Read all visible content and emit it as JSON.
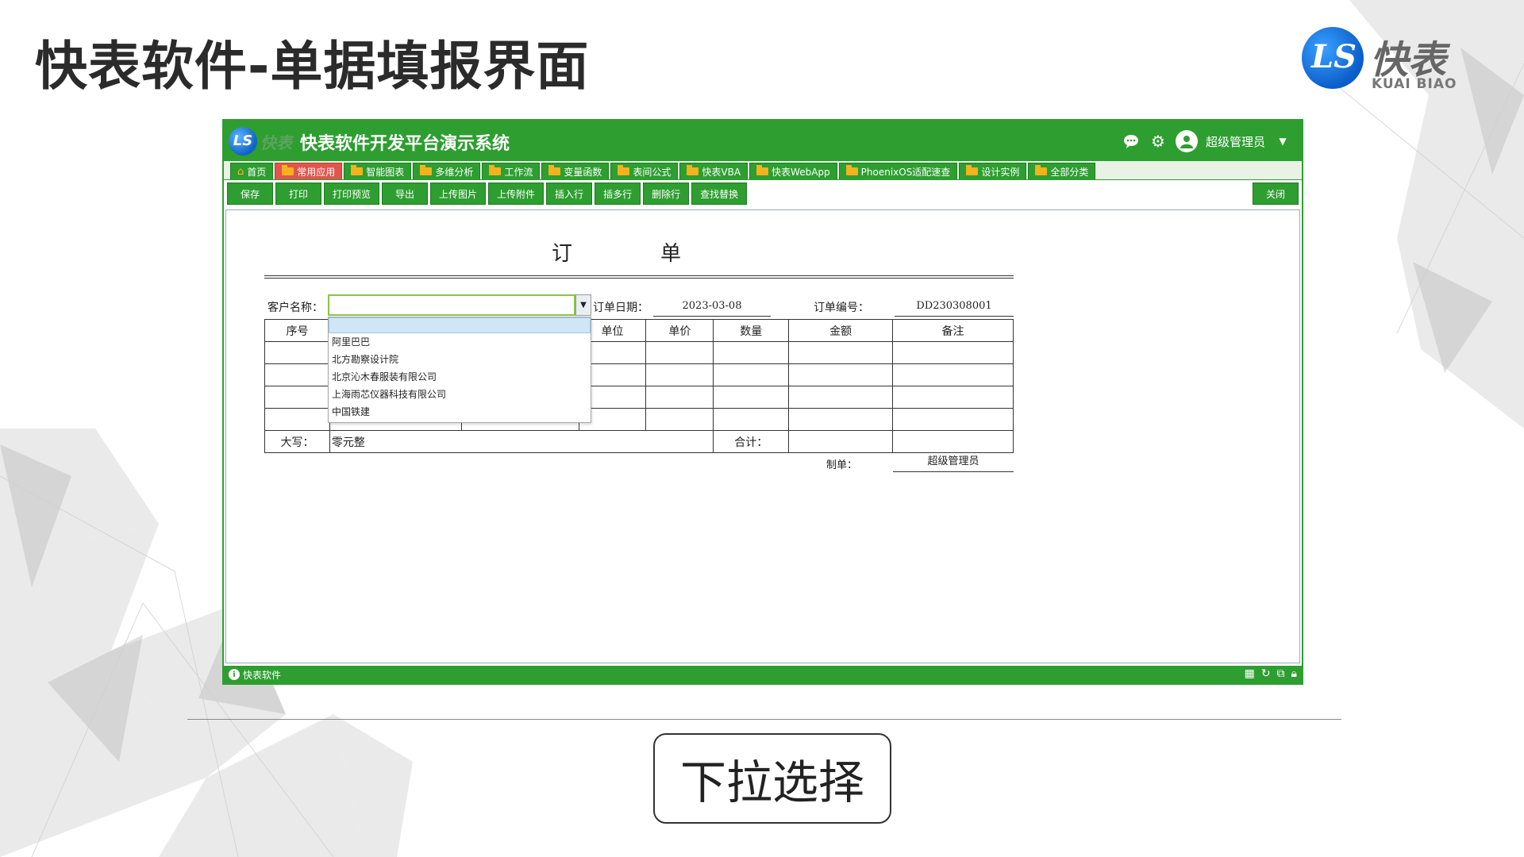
{
  "slide": {
    "title": "快表软件-单据填报界面",
    "brand": {
      "mark": "LS",
      "cn": "快表",
      "en": "KUAI BIAO"
    },
    "caption": "下拉选择"
  },
  "app": {
    "logo_mark": "LS",
    "logo_cn": "快表",
    "title": "快表软件开发平台演示系统",
    "user": "超级管理员",
    "header_icons": [
      "chat-icon",
      "gear-icon",
      "user-icon",
      "caret-down-icon"
    ],
    "tabs": [
      {
        "label": "首页",
        "icon": "home-icon",
        "active": false
      },
      {
        "label": "常用应用",
        "icon": "folder-icon",
        "active": true
      },
      {
        "label": "智能图表",
        "icon": "folder-icon",
        "active": false
      },
      {
        "label": "多维分析",
        "icon": "folder-icon",
        "active": false
      },
      {
        "label": "工作流",
        "icon": "folder-icon",
        "active": false
      },
      {
        "label": "变量函数",
        "icon": "folder-icon",
        "active": false
      },
      {
        "label": "表间公式",
        "icon": "folder-icon",
        "active": false
      },
      {
        "label": "快表VBA",
        "icon": "folder-icon",
        "active": false
      },
      {
        "label": "快表WebApp",
        "icon": "folder-icon",
        "active": false
      },
      {
        "label": "PhoenixOS适配速查",
        "icon": "folder-icon",
        "active": false
      },
      {
        "label": "设计实例",
        "icon": "folder-icon",
        "active": false
      },
      {
        "label": "全部分类",
        "icon": "folder-icon",
        "active": false
      }
    ],
    "toolbar": [
      "保存",
      "打印",
      "打印预览",
      "导出",
      "上传图片",
      "上传附件",
      "插入行",
      "插多行",
      "删除行",
      "查找替换"
    ],
    "close_label": "关闭",
    "status_text": "快表软件",
    "status_icons": [
      "grid-icon",
      "refresh-icon",
      "external-icon",
      "lock-icon"
    ]
  },
  "form": {
    "title_left": "订",
    "title_right": "单",
    "customer_label": "客户名称：",
    "customer_value": "",
    "date_label": "订单日期：",
    "date_value": "2023-03-08",
    "number_label": "订单编号：",
    "number_value": "DD230308001",
    "columns": [
      "序号",
      "",
      "",
      "单位",
      "单价",
      "数量",
      "金额",
      "备注"
    ],
    "rows": 4,
    "daxie_label": "大写：",
    "daxie_value": "零元整",
    "total_label": "合计：",
    "total_value": "",
    "maker_label": "制单：",
    "maker_value": "超级管理员"
  },
  "dropdown": {
    "options": [
      "",
      "阿里巴巴",
      "北方勘察设计院",
      "北京沁木春服装有限公司",
      "上海雨芯仪器科技有限公司",
      "中国铁建"
    ]
  }
}
